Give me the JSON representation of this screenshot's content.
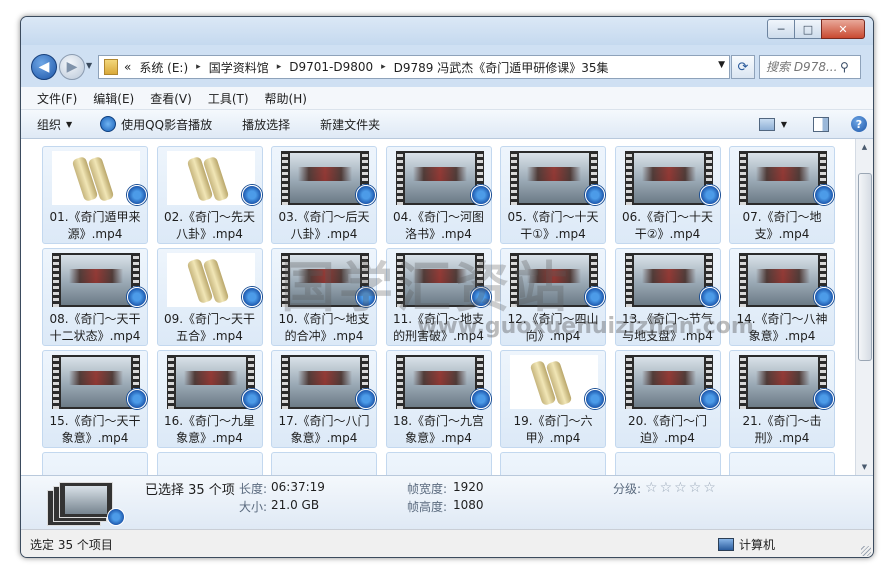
{
  "window": {
    "minimize": "─",
    "maximize": "□",
    "close": "✕"
  },
  "nav": {
    "back": "◀",
    "forward": "▶"
  },
  "address": {
    "chevron": "«",
    "crumbs": [
      "系统 (E:)",
      "国学资料馆",
      "D9701-D9800",
      "D9789 冯武杰《奇门遁甲研修课》35集"
    ],
    "separator": "▸"
  },
  "search": {
    "placeholder": "搜索 D978..."
  },
  "menu": [
    "文件(F)",
    "编辑(E)",
    "查看(V)",
    "工具(T)",
    "帮助(H)"
  ],
  "toolbar": {
    "organize": "组织",
    "play_qq": "使用QQ影音播放",
    "play_select": "播放选择",
    "new_folder": "新建文件夹"
  },
  "files": [
    {
      "label": "01.《奇门遁甲来源》.mp4",
      "thumb": "scroll"
    },
    {
      "label": "02.《奇门～先天八卦》.mp4",
      "thumb": "scroll"
    },
    {
      "label": "03.《奇门～后天八卦》.mp4",
      "thumb": "film"
    },
    {
      "label": "04.《奇门～河图洛书》.mp4",
      "thumb": "film"
    },
    {
      "label": "05.《奇门～十天干①》.mp4",
      "thumb": "film"
    },
    {
      "label": "06.《奇门～十天干②》.mp4",
      "thumb": "film"
    },
    {
      "label": "07.《奇门～地支》.mp4",
      "thumb": "film"
    },
    {
      "label": "08.《奇门～天干十二状态》.mp4",
      "thumb": "film"
    },
    {
      "label": "09.《奇门～天干五合》.mp4",
      "thumb": "scroll"
    },
    {
      "label": "10.《奇门～地支的合冲》.mp4",
      "thumb": "film"
    },
    {
      "label": "11.《奇门～地支的刑害破》.mp4",
      "thumb": "film"
    },
    {
      "label": "12.《奇门～四山向》.mp4",
      "thumb": "film"
    },
    {
      "label": "13.《奇门～节气与地支盘》.mp4",
      "thumb": "film"
    },
    {
      "label": "14.《奇门～八神象意》.mp4",
      "thumb": "film"
    },
    {
      "label": "15.《奇门～天干象意》.mp4",
      "thumb": "film"
    },
    {
      "label": "16.《奇门～九星象意》.mp4",
      "thumb": "film"
    },
    {
      "label": "17.《奇门～八门象意》.mp4",
      "thumb": "film"
    },
    {
      "label": "18.《奇门～九宫象意》.mp4",
      "thumb": "film"
    },
    {
      "label": "19.《奇门～六甲》.mp4",
      "thumb": "scroll"
    },
    {
      "label": "20.《奇门～门迫》.mp4",
      "thumb": "film"
    },
    {
      "label": "21.《奇门～击刑》.mp4",
      "thumb": "film"
    },
    {
      "label": "",
      "thumb": "none"
    },
    {
      "label": "",
      "thumb": "none"
    },
    {
      "label": "",
      "thumb": "none"
    },
    {
      "label": "",
      "thumb": "none"
    },
    {
      "label": "",
      "thumb": "none"
    },
    {
      "label": "",
      "thumb": "none"
    },
    {
      "label": "",
      "thumb": "none"
    }
  ],
  "watermark": {
    "text": "国学汇资站",
    "url": "www.guoxuehuizizhan.com"
  },
  "details": {
    "selected": "已选择 35 个项",
    "length_label": "长度:",
    "length": "06:37:19",
    "size_label": "大小:",
    "size": "21.0 GB",
    "frame_width_label": "帧宽度:",
    "frame_width": "1920",
    "frame_height_label": "帧高度:",
    "frame_height": "1080",
    "rating_label": "分级:",
    "rating_stars": 0
  },
  "status": {
    "left": "选定 35 个项目",
    "right": "计算机"
  },
  "scrollbar": {
    "up": "▲",
    "down": "▼"
  }
}
